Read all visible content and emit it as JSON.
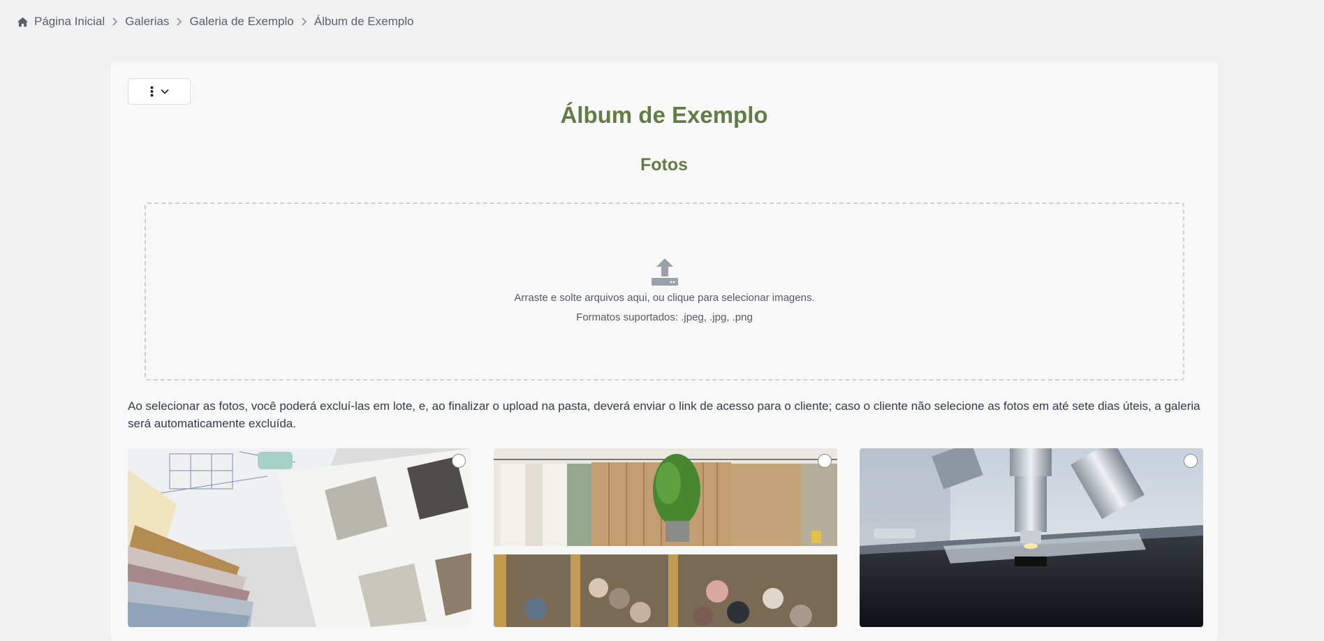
{
  "breadcrumb": {
    "items": [
      {
        "label": "Página Inicial",
        "icon": "home-icon"
      },
      {
        "label": "Galerias"
      },
      {
        "label": "Galeria de Exemplo"
      },
      {
        "label": "Álbum de Exemplo"
      }
    ]
  },
  "album": {
    "title": "Álbum de Exemplo",
    "section_title": "Fotos"
  },
  "upload": {
    "instruction": "Arraste e solte arquivos aqui, ou clique para selecionar imagens.",
    "formats": "Formatos suportados: .jpeg, .jpg, .png",
    "icon": "upload-icon"
  },
  "notice": "Ao selecionar as fotos, você poderá excluí-las em lote, e, ao finalizar o upload na pasta, deverá enviar o link de acesso para o cliente; caso o cliente não selecione as fotos em até sete dias úteis, a galeria será automaticamente excluída.",
  "photos": [
    {
      "subject": "color swatches and material samples on blueprints",
      "selected": false
    },
    {
      "subject": "clothing rack with paper patterns and fabric rolls",
      "selected": false
    },
    {
      "subject": "laboratory microscope close-up",
      "selected": false
    }
  ],
  "colors": {
    "accent": "#627c47",
    "background": "#f1f1f1",
    "card": "#f8f8f8"
  }
}
